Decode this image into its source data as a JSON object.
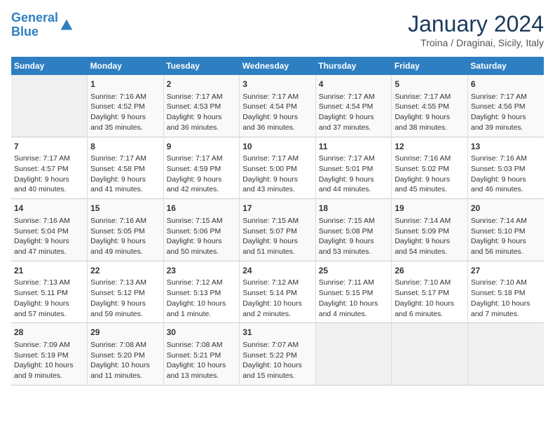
{
  "header": {
    "logo_line1": "General",
    "logo_line2": "Blue",
    "month_title": "January 2024",
    "location": "Troina / Draginai, Sicily, Italy"
  },
  "weekdays": [
    "Sunday",
    "Monday",
    "Tuesday",
    "Wednesday",
    "Thursday",
    "Friday",
    "Saturday"
  ],
  "weeks": [
    [
      {
        "day": "",
        "info": ""
      },
      {
        "day": "1",
        "info": "Sunrise: 7:16 AM\nSunset: 4:52 PM\nDaylight: 9 hours\nand 35 minutes."
      },
      {
        "day": "2",
        "info": "Sunrise: 7:17 AM\nSunset: 4:53 PM\nDaylight: 9 hours\nand 36 minutes."
      },
      {
        "day": "3",
        "info": "Sunrise: 7:17 AM\nSunset: 4:54 PM\nDaylight: 9 hours\nand 36 minutes."
      },
      {
        "day": "4",
        "info": "Sunrise: 7:17 AM\nSunset: 4:54 PM\nDaylight: 9 hours\nand 37 minutes."
      },
      {
        "day": "5",
        "info": "Sunrise: 7:17 AM\nSunset: 4:55 PM\nDaylight: 9 hours\nand 38 minutes."
      },
      {
        "day": "6",
        "info": "Sunrise: 7:17 AM\nSunset: 4:56 PM\nDaylight: 9 hours\nand 39 minutes."
      }
    ],
    [
      {
        "day": "7",
        "info": "Sunrise: 7:17 AM\nSunset: 4:57 PM\nDaylight: 9 hours\nand 40 minutes."
      },
      {
        "day": "8",
        "info": "Sunrise: 7:17 AM\nSunset: 4:58 PM\nDaylight: 9 hours\nand 41 minutes."
      },
      {
        "day": "9",
        "info": "Sunrise: 7:17 AM\nSunset: 4:59 PM\nDaylight: 9 hours\nand 42 minutes."
      },
      {
        "day": "10",
        "info": "Sunrise: 7:17 AM\nSunset: 5:00 PM\nDaylight: 9 hours\nand 43 minutes."
      },
      {
        "day": "11",
        "info": "Sunrise: 7:17 AM\nSunset: 5:01 PM\nDaylight: 9 hours\nand 44 minutes."
      },
      {
        "day": "12",
        "info": "Sunrise: 7:16 AM\nSunset: 5:02 PM\nDaylight: 9 hours\nand 45 minutes."
      },
      {
        "day": "13",
        "info": "Sunrise: 7:16 AM\nSunset: 5:03 PM\nDaylight: 9 hours\nand 46 minutes."
      }
    ],
    [
      {
        "day": "14",
        "info": "Sunrise: 7:16 AM\nSunset: 5:04 PM\nDaylight: 9 hours\nand 47 minutes."
      },
      {
        "day": "15",
        "info": "Sunrise: 7:16 AM\nSunset: 5:05 PM\nDaylight: 9 hours\nand 49 minutes."
      },
      {
        "day": "16",
        "info": "Sunrise: 7:15 AM\nSunset: 5:06 PM\nDaylight: 9 hours\nand 50 minutes."
      },
      {
        "day": "17",
        "info": "Sunrise: 7:15 AM\nSunset: 5:07 PM\nDaylight: 9 hours\nand 51 minutes."
      },
      {
        "day": "18",
        "info": "Sunrise: 7:15 AM\nSunset: 5:08 PM\nDaylight: 9 hours\nand 53 minutes."
      },
      {
        "day": "19",
        "info": "Sunrise: 7:14 AM\nSunset: 5:09 PM\nDaylight: 9 hours\nand 54 minutes."
      },
      {
        "day": "20",
        "info": "Sunrise: 7:14 AM\nSunset: 5:10 PM\nDaylight: 9 hours\nand 56 minutes."
      }
    ],
    [
      {
        "day": "21",
        "info": "Sunrise: 7:13 AM\nSunset: 5:11 PM\nDaylight: 9 hours\nand 57 minutes."
      },
      {
        "day": "22",
        "info": "Sunrise: 7:13 AM\nSunset: 5:12 PM\nDaylight: 9 hours\nand 59 minutes."
      },
      {
        "day": "23",
        "info": "Sunrise: 7:12 AM\nSunset: 5:13 PM\nDaylight: 10 hours\nand 1 minute."
      },
      {
        "day": "24",
        "info": "Sunrise: 7:12 AM\nSunset: 5:14 PM\nDaylight: 10 hours\nand 2 minutes."
      },
      {
        "day": "25",
        "info": "Sunrise: 7:11 AM\nSunset: 5:15 PM\nDaylight: 10 hours\nand 4 minutes."
      },
      {
        "day": "26",
        "info": "Sunrise: 7:10 AM\nSunset: 5:17 PM\nDaylight: 10 hours\nand 6 minutes."
      },
      {
        "day": "27",
        "info": "Sunrise: 7:10 AM\nSunset: 5:18 PM\nDaylight: 10 hours\nand 7 minutes."
      }
    ],
    [
      {
        "day": "28",
        "info": "Sunrise: 7:09 AM\nSunset: 5:19 PM\nDaylight: 10 hours\nand 9 minutes."
      },
      {
        "day": "29",
        "info": "Sunrise: 7:08 AM\nSunset: 5:20 PM\nDaylight: 10 hours\nand 11 minutes."
      },
      {
        "day": "30",
        "info": "Sunrise: 7:08 AM\nSunset: 5:21 PM\nDaylight: 10 hours\nand 13 minutes."
      },
      {
        "day": "31",
        "info": "Sunrise: 7:07 AM\nSunset: 5:22 PM\nDaylight: 10 hours\nand 15 minutes."
      },
      {
        "day": "",
        "info": ""
      },
      {
        "day": "",
        "info": ""
      },
      {
        "day": "",
        "info": ""
      }
    ]
  ]
}
